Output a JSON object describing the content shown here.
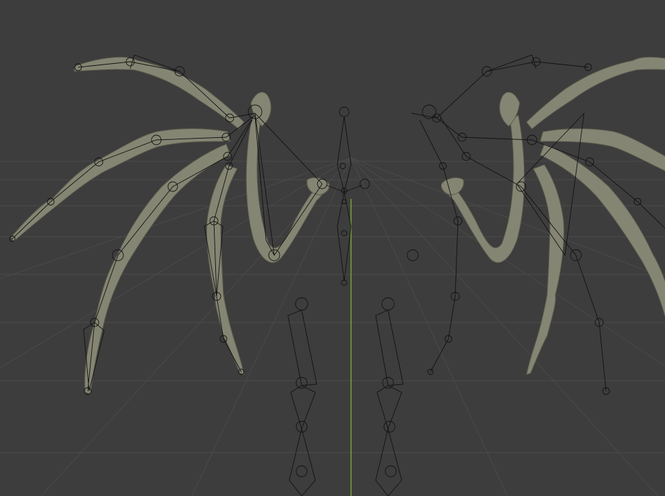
{
  "viewport": {
    "background": "#3d3d3d",
    "grid_color": "#4a4a4a",
    "axis_y_color": "#7aa33a",
    "mesh_color": "#858573",
    "armature_color": "#111111"
  }
}
